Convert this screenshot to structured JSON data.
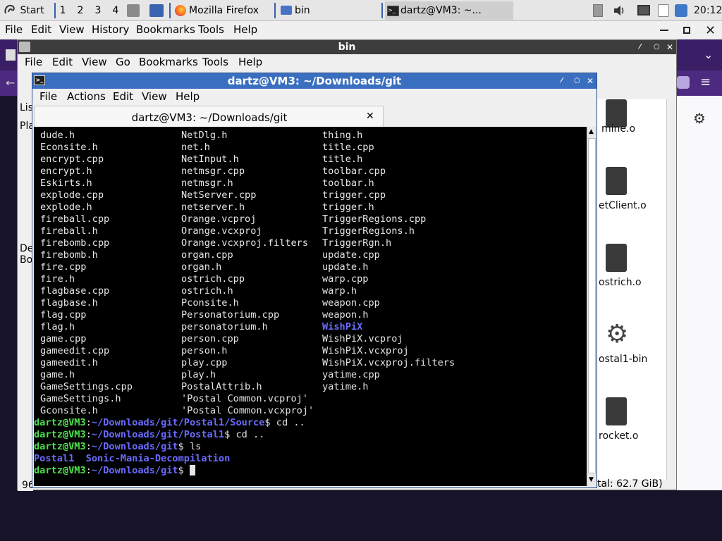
{
  "taskbar": {
    "start_label": "Start",
    "workspaces": [
      "1",
      "2",
      "3",
      "4"
    ],
    "tasks": [
      {
        "label": "Mozilla Firefox",
        "icon": "firefox-icon"
      },
      {
        "label": "bin",
        "icon": "folder-icon"
      },
      {
        "label": "dartz@VM3: ~...",
        "icon": "terminal-icon"
      }
    ],
    "clock": "20:12"
  },
  "firefox": {
    "menu": [
      "File",
      "Edit",
      "View",
      "History",
      "Bookmarks",
      "Tools",
      "Help"
    ]
  },
  "filemanager": {
    "title": "bin",
    "menu": [
      "File",
      "Edit",
      "View",
      "Go",
      "Bookmarks",
      "Tools",
      "Help"
    ],
    "side_fragments": [
      "Lis",
      "Pla",
      "De",
      "Bo"
    ],
    "status_left": "96",
    "status_right": "tal: 62.7 GiB)",
    "files": [
      {
        "name": "mine.o",
        "icon": "binary-file-icon"
      },
      {
        "name": "etClient.o",
        "icon": "binary-file-icon"
      },
      {
        "name": "ostrich.o",
        "icon": "binary-file-icon"
      },
      {
        "name": "ostal1-bin",
        "icon": "gear-icon"
      },
      {
        "name": "rocket.o",
        "icon": "binary-file-icon"
      }
    ]
  },
  "terminal": {
    "title": "dartz@VM3: ~/Downloads/git",
    "menu": [
      "File",
      "Actions",
      "Edit",
      "View",
      "Help"
    ],
    "tab_title": "dartz@VM3: ~/Downloads/git",
    "col1": [
      "dude.h",
      "Econsite.h",
      "encrypt.cpp",
      "encrypt.h",
      "Eskirts.h",
      "explode.cpp",
      "explode.h",
      "fireball.cpp",
      "fireball.h",
      "firebomb.cpp",
      "firebomb.h",
      "fire.cpp",
      "fire.h",
      "flagbase.cpp",
      "flagbase.h",
      "flag.cpp",
      "flag.h",
      "game.cpp",
      "gameedit.cpp",
      "gameedit.h",
      "game.h",
      "GameSettings.cpp",
      "GameSettings.h",
      "Gconsite.h"
    ],
    "col2": [
      "NetDlg.h",
      "net.h",
      "NetInput.h",
      "netmsgr.cpp",
      "netmsgr.h",
      "NetServer.cpp",
      "netserver.h",
      "Orange.vcproj",
      "Orange.vcxproj",
      "Orange.vcxproj.filters",
      "organ.cpp",
      "organ.h",
      "ostrich.cpp",
      "ostrich.h",
      "Pconsite.h",
      "Personatorium.cpp",
      "personatorium.h",
      "person.cpp",
      "person.h",
      "play.cpp",
      "play.h",
      "PostalAttrib.h",
      "'Postal Common.vcproj'",
      "'Postal Common.vcxproj'"
    ],
    "col3": [
      "thing.h",
      "title.cpp",
      "title.h",
      "toolbar.cpp",
      "toolbar.h",
      "trigger.cpp",
      "trigger.h",
      "TriggerRegions.cpp",
      "TriggerRegions.h",
      "TriggerRgn.h",
      "update.cpp",
      "update.h",
      "warp.cpp",
      "warp.h",
      "weapon.cpp",
      "weapon.h",
      "WishPiX",
      "WishPiX.vcproj",
      "WishPiX.vcxproj",
      "WishPiX.vcxproj.filters",
      "yatime.cpp",
      "yatime.h"
    ],
    "prompts": [
      {
        "user": "dartz@VM3",
        "path": "~/Downloads/git/Postal1/Source",
        "cmd": " cd .."
      },
      {
        "user": "dartz@VM3",
        "path": "~/Downloads/git/Postal1",
        "cmd": " cd .."
      },
      {
        "user": "dartz@VM3",
        "path": "~/Downloads/git",
        "cmd": " ls"
      }
    ],
    "ls_output": [
      "Postal1",
      "Sonic-Mania-Decompilation"
    ],
    "last_prompt": {
      "user": "dartz@VM3",
      "path": "~/Downloads/git",
      "cmd": " "
    }
  }
}
